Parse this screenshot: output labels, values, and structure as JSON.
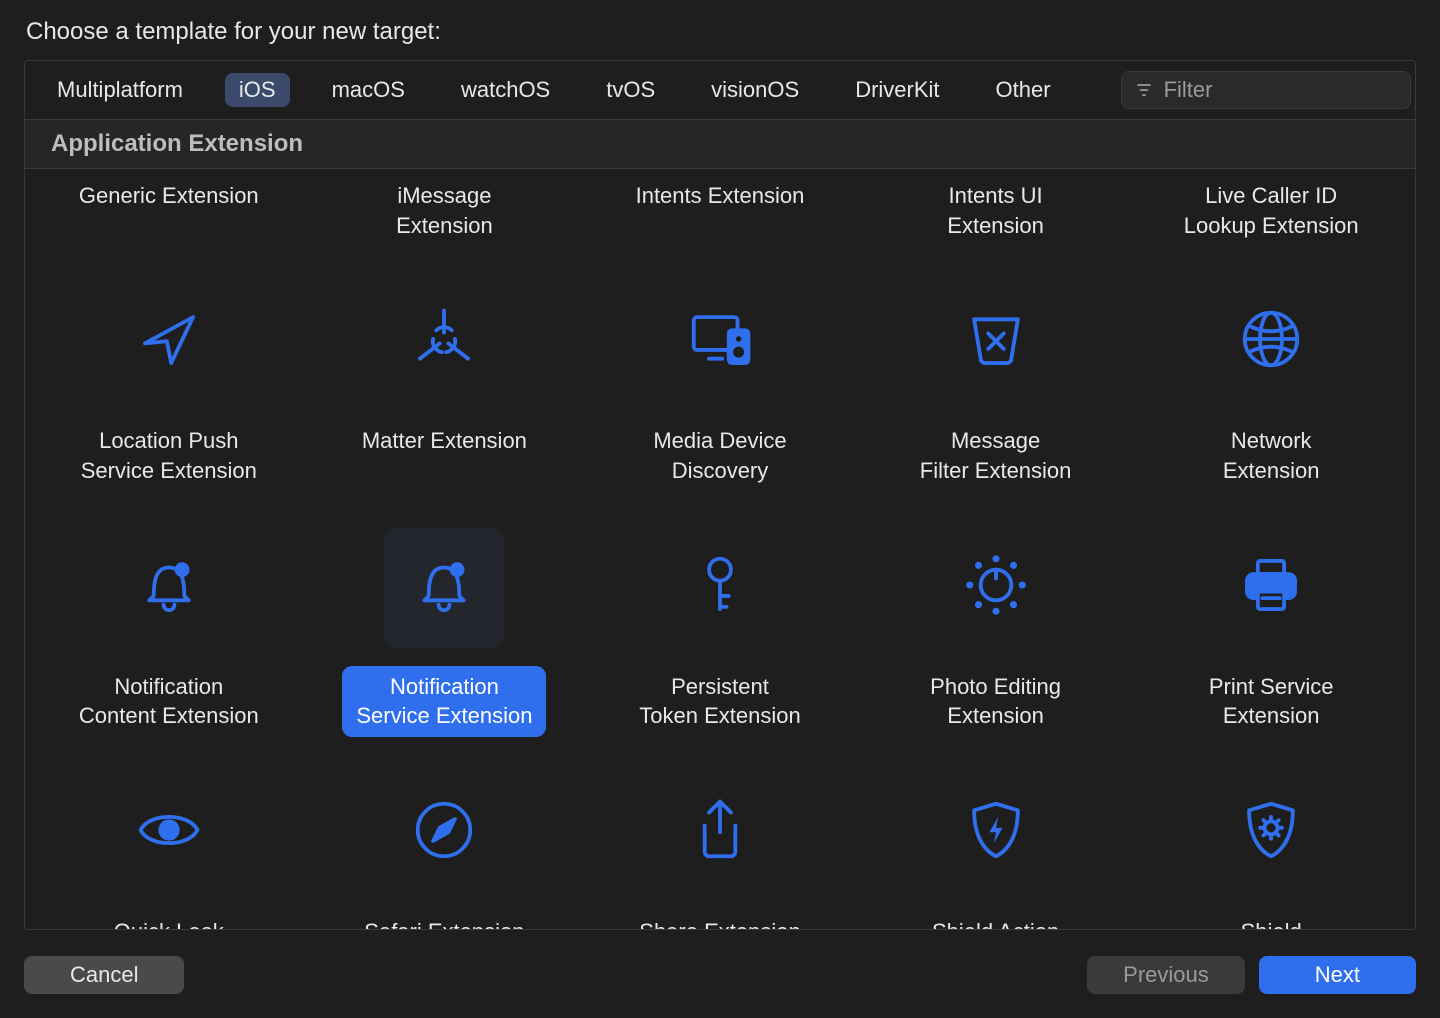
{
  "title": "Choose a template for your new target:",
  "tabs": [
    {
      "id": "multiplatform",
      "label": "Multiplatform",
      "selected": false
    },
    {
      "id": "ios",
      "label": "iOS",
      "selected": true
    },
    {
      "id": "macos",
      "label": "macOS",
      "selected": false
    },
    {
      "id": "watchos",
      "label": "watchOS",
      "selected": false
    },
    {
      "id": "tvos",
      "label": "tvOS",
      "selected": false
    },
    {
      "id": "visionos",
      "label": "visionOS",
      "selected": false
    },
    {
      "id": "driverkit",
      "label": "DriverKit",
      "selected": false
    },
    {
      "id": "other",
      "label": "Other",
      "selected": false
    }
  ],
  "filter": {
    "placeholder": "Filter",
    "value": ""
  },
  "section_title": "Application Extension",
  "templates": [
    {
      "id": "generic-extension",
      "label": "Generic Extension",
      "icon": null,
      "selected": false
    },
    {
      "id": "imessage-extension",
      "label": "iMessage\nExtension",
      "icon": null,
      "selected": false
    },
    {
      "id": "intents-extension",
      "label": "Intents Extension",
      "icon": null,
      "selected": false
    },
    {
      "id": "intents-ui-extension",
      "label": "Intents UI\nExtension",
      "icon": null,
      "selected": false
    },
    {
      "id": "live-caller-id-lookup-extension",
      "label": "Live Caller ID\nLookup Extension",
      "icon": null,
      "selected": false
    },
    {
      "id": "location-push-service-extension",
      "label": "Location Push\nService Extension",
      "icon": "location",
      "selected": false
    },
    {
      "id": "matter-extension",
      "label": "Matter Extension",
      "icon": "matter",
      "selected": false
    },
    {
      "id": "media-device-discovery",
      "label": "Media Device\nDiscovery",
      "icon": "media",
      "selected": false
    },
    {
      "id": "message-filter-extension",
      "label": "Message\nFilter Extension",
      "icon": "trash",
      "selected": false
    },
    {
      "id": "network-extension",
      "label": "Network\nExtension",
      "icon": "globe",
      "selected": false
    },
    {
      "id": "notification-content-extension",
      "label": "Notification\nContent Extension",
      "icon": "bell",
      "selected": false
    },
    {
      "id": "notification-service-extension",
      "label": "Notification\nService Extension",
      "icon": "bell",
      "selected": true
    },
    {
      "id": "persistent-token-extension",
      "label": "Persistent\nToken Extension",
      "icon": "key",
      "selected": false
    },
    {
      "id": "photo-editing-extension",
      "label": "Photo Editing\nExtension",
      "icon": "sun",
      "selected": false
    },
    {
      "id": "print-service-extension",
      "label": "Print Service\nExtension",
      "icon": "printer",
      "selected": false
    },
    {
      "id": "quick-look-preview-extension",
      "label": "Quick Look\nPreview Extension",
      "icon": "eye",
      "selected": false
    },
    {
      "id": "safari-extension",
      "label": "Safari Extension",
      "icon": "compass",
      "selected": false
    },
    {
      "id": "share-extension",
      "label": "Share Extension",
      "icon": "share",
      "selected": false
    },
    {
      "id": "shield-action-extension",
      "label": "Shield Action\nExtension",
      "icon": "shield-bolt",
      "selected": false
    },
    {
      "id": "shield-configuration",
      "label": "Shield\nConfiguration",
      "icon": "shield-gear",
      "selected": false
    }
  ],
  "buttons": {
    "cancel": "Cancel",
    "previous": "Previous",
    "next": "Next"
  }
}
